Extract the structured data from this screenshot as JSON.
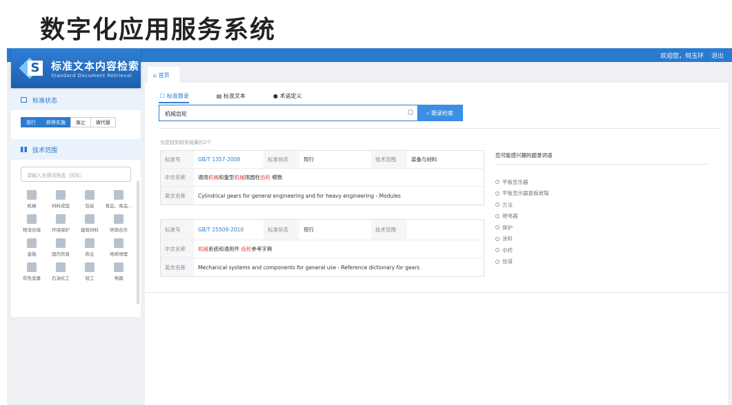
{
  "slide_title": "数字化应用服务系统",
  "topbar": {
    "welcome": "欢迎您，何玉环",
    "logout": "退出"
  },
  "logo": {
    "letter": "S",
    "cn": "标准文本内容检索",
    "en": "Standard Document Retrieval"
  },
  "sidebar": {
    "status_section": "标准状态",
    "status_buttons": [
      "现行",
      "即将实施",
      "废止",
      "被代替"
    ],
    "tech_section": "技术范围",
    "tech_placeholder": "请输入关键词筛选（回车）",
    "categories": [
      "机械",
      "材料成型",
      "包装",
      "食品、食品...",
      "物流仓储",
      "环境保护",
      "建筑材料",
      "供销合作",
      "金融",
      "国内贸易",
      "商业",
      "地质地理",
      "有色金属",
      "石油化工",
      "轻工",
      "电器"
    ]
  },
  "main": {
    "home_tab": "首页",
    "search_tabs": [
      "标准题录",
      "标准文本",
      "术语定义"
    ],
    "search_value": "机械齿轮",
    "search_button": "题录检索",
    "found_text": "为您找到相关结果约2个",
    "results": [
      {
        "no_label": "标准号",
        "no": "GB/T 1357-2008",
        "status_label": "标准状态",
        "status": "现行",
        "scope_label": "技术范围",
        "scope": "装备与材料",
        "cn_label": "中文名称",
        "cn_parts": [
          "通用",
          "机械",
          "和重型",
          "机械",
          "用圆柱",
          "齿轮",
          " 模数"
        ],
        "en_label": "英文名称",
        "en": "Cylindrical gears for general engineering and for heavy engineering - Modules"
      },
      {
        "no_label": "标准号",
        "no": "GB/T 25509-2010",
        "status_label": "标准状态",
        "status": "现行",
        "scope_label": "技术范围",
        "scope": "",
        "cn_label": "中文名称",
        "cn_parts": [
          "机械",
          "系统和通用件 ",
          "齿轮",
          "参考字典"
        ],
        "en_label": "英文名称",
        "en": "Mechanical systems and components for general use - Reference dictionary for gears"
      }
    ],
    "related_title": "您可能感兴趣的题录词语",
    "related": [
      "平板显示器",
      "平板显示器基板玻璃",
      "方法",
      "继电器",
      "保护",
      "涂料",
      "中药",
      "信道"
    ]
  }
}
